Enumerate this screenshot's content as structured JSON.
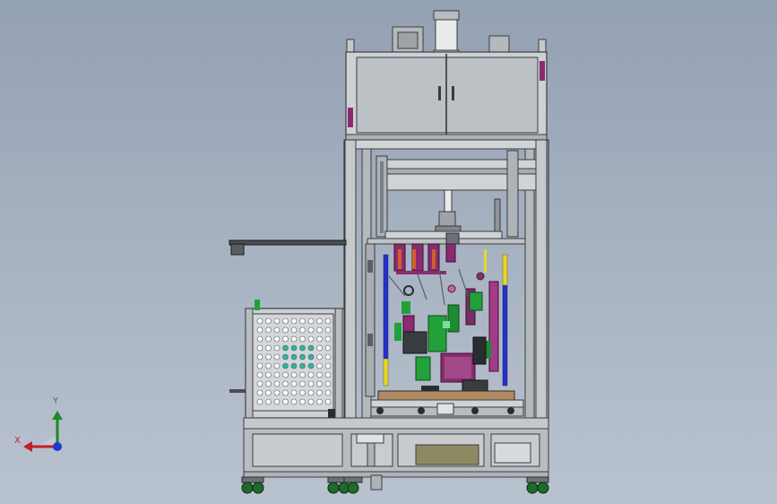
{
  "viewport": {
    "background": [
      "#94a1b3",
      "#b9c2cf"
    ]
  },
  "triad": {
    "x_label": "X",
    "y_label": "Y",
    "x_color": "#c0202c",
    "y_color": "#1a8a24",
    "z_color": "#1a3ad0"
  },
  "model": {
    "frame_color": "#c5c9cc",
    "edge_color": "#3a3d40",
    "cabinet_color": "#b9bec2",
    "accent_magenta": "#8a2b70",
    "accent_blue": "#2432c8",
    "accent_yellow": "#e6d72a",
    "accent_green": "#22a03a",
    "accent_teal": "#2cb5a0"
  }
}
